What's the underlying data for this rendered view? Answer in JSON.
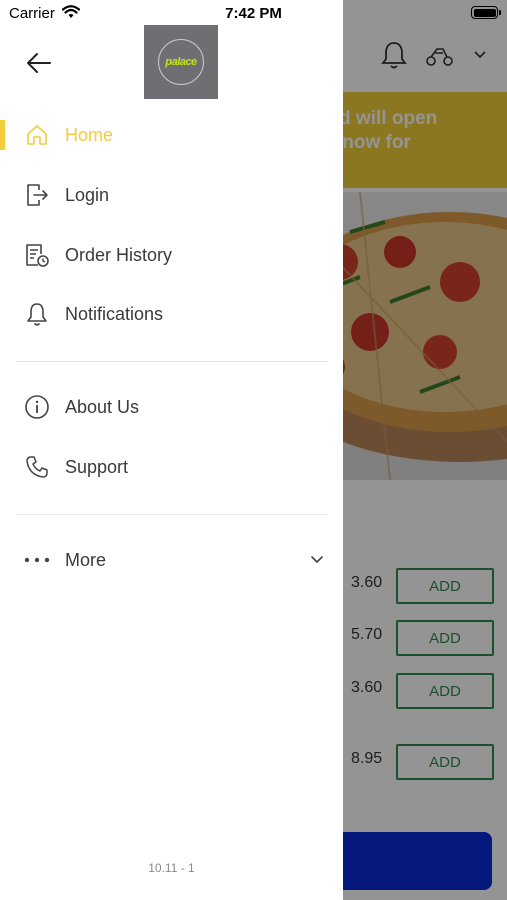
{
  "status_bar": {
    "carrier": "Carrier",
    "time": "7:42 PM"
  },
  "logo": {
    "text": "palace"
  },
  "menu": {
    "primary": [
      {
        "label": "Home",
        "icon": "home-icon",
        "active": true
      },
      {
        "label": "Login",
        "icon": "login-icon"
      },
      {
        "label": "Order History",
        "icon": "order-history-icon"
      },
      {
        "label": "Notifications",
        "icon": "bell-icon"
      }
    ],
    "secondary": [
      {
        "label": "About Us",
        "icon": "info-icon"
      },
      {
        "label": "Support",
        "icon": "phone-icon"
      }
    ],
    "more": {
      "label": "More",
      "icon": "more-icon"
    }
  },
  "version": "10.11 - 1",
  "background": {
    "banner_lines": [
      "d and will open",
      "rder now for"
    ],
    "items": [
      {
        "price": "3.60",
        "add_label": "ADD"
      },
      {
        "price": "5.70",
        "add_label": "ADD"
      },
      {
        "price": "3.60",
        "add_label": "ADD"
      },
      {
        "price": "8.95",
        "add_label": "ADD"
      }
    ]
  },
  "colors": {
    "accent": "#f1cd3a",
    "add_green": "#2e8b4f",
    "cta_blue": "#0a2bd6"
  }
}
